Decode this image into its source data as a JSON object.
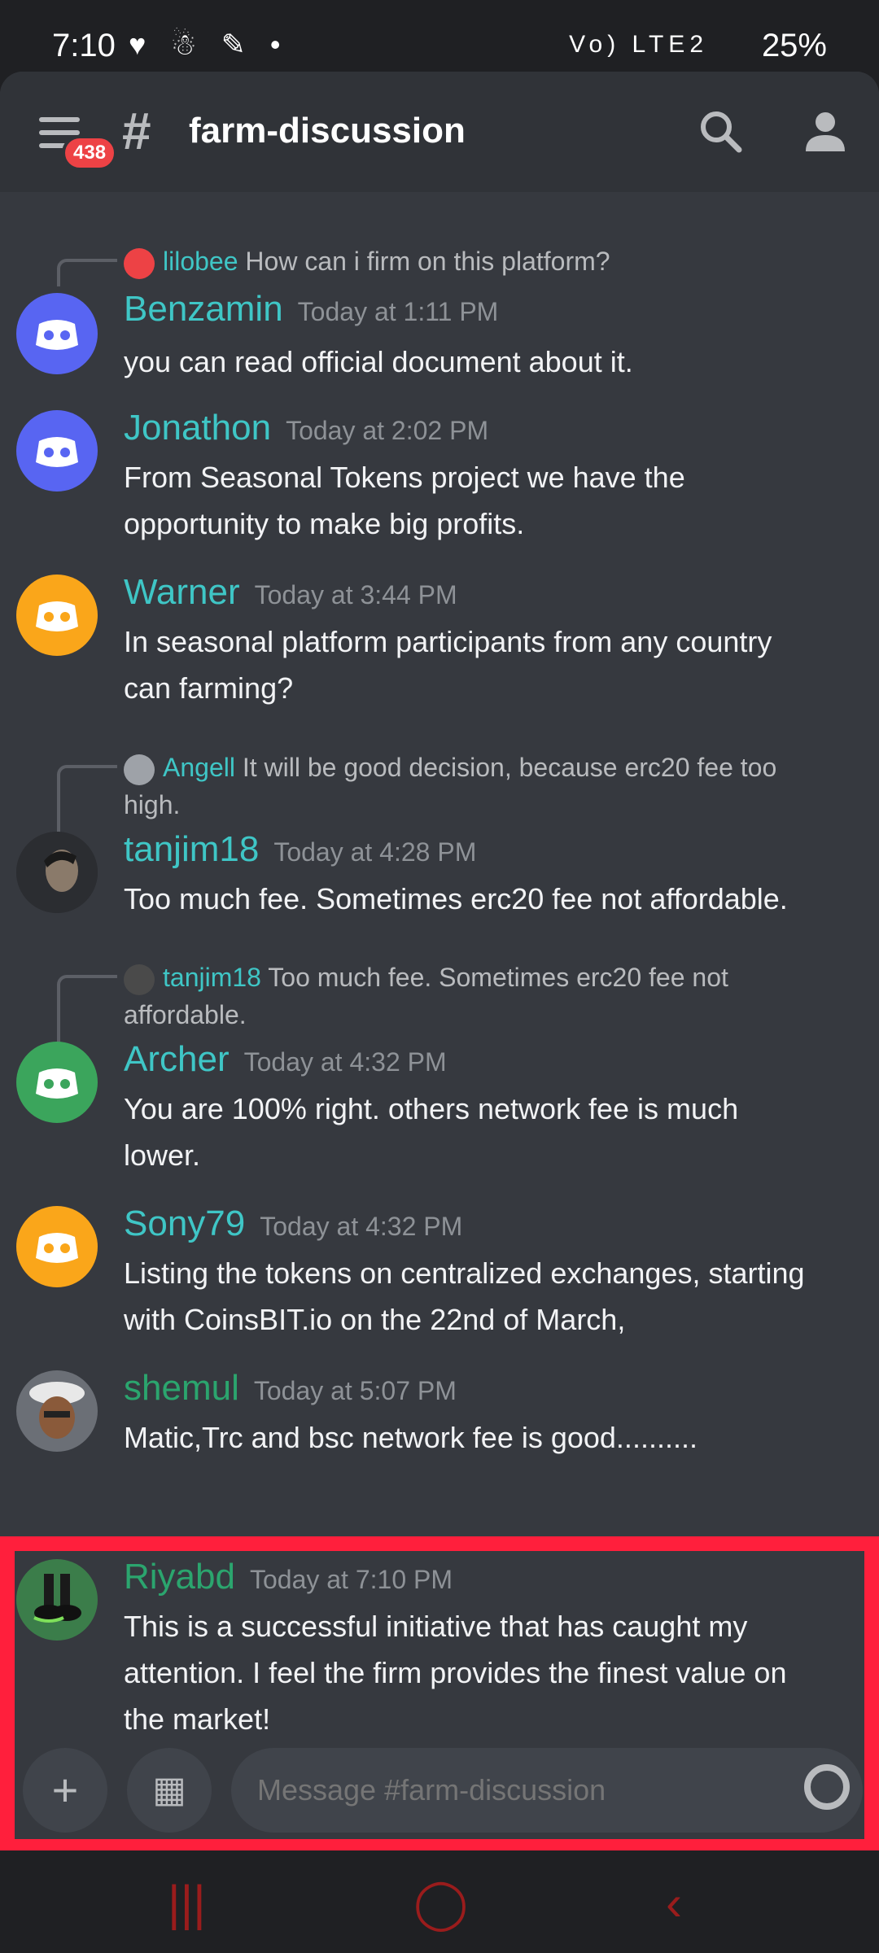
{
  "status_bar": {
    "time": "7:10",
    "left_icons": "♥ ☃ ✎ •",
    "signal": "Vo) LTE2",
    "battery": "25%"
  },
  "header": {
    "badge_count": "438",
    "channel_name": "farm-discussion"
  },
  "messages": [
    {
      "reply": {
        "user": "lilobee",
        "text": "How can i firm on this platform?"
      },
      "user": "Benzamin",
      "time": "Today at 1:11 PM",
      "lines": [
        "you can read official document about it."
      ],
      "avatar_color": "#5865f2"
    },
    {
      "user": "Jonathon",
      "time": "Today at 2:02 PM",
      "lines": [
        "From Seasonal Tokens project we have the",
        "opportunity to make big profits."
      ],
      "avatar_color": "#5865f2"
    },
    {
      "user": "Warner",
      "time": "Today at 3:44 PM",
      "lines": [
        "In seasonal platform participants from any country",
        "can farming?"
      ],
      "avatar_color": "#faa61a"
    },
    {
      "reply": {
        "user": "Angell",
        "text": "It will be good decision, because erc20 fee too",
        "text2": "high."
      },
      "user": "tanjim18",
      "time": "Today at 4:28 PM",
      "lines": [
        "Too much fee. Sometimes erc20 fee not affordable."
      ],
      "avatar_color": "#2b2d31"
    },
    {
      "reply": {
        "user": "tanjim18",
        "text": "Too much fee. Sometimes erc20 fee not",
        "text2": "affordable."
      },
      "user": "Archer",
      "time": "Today at 4:32 PM",
      "lines": [
        "You are 100%  right. others network fee is much",
        "lower."
      ],
      "avatar_color": "#3ba55c"
    },
    {
      "user": "Sony79",
      "time": "Today at 4:32 PM",
      "lines": [
        "Listing the tokens on centralized exchanges, starting",
        "with CoinsBIT.io on the 22nd of March,"
      ],
      "avatar_color": "#faa61a"
    },
    {
      "user": "shemul",
      "time": "Today at 5:07 PM",
      "lines": [
        "Matic,Trc and bsc network fee  is good.........."
      ],
      "avatar_color": "#6b6f76"
    },
    {
      "user": "Riyabd",
      "time": "Today at 7:10 PM",
      "lines": [
        "This is a successful initiative that has caught my",
        "attention. I feel the firm provides the finest value on",
        "the market!"
      ],
      "avatar_color": "#3b7d4a"
    }
  ],
  "input": {
    "placeholder": "Message #farm-discussion"
  },
  "colors": {
    "highlight": "#ff1f3c",
    "username": "#3fc6c6",
    "background": "#36393f"
  }
}
